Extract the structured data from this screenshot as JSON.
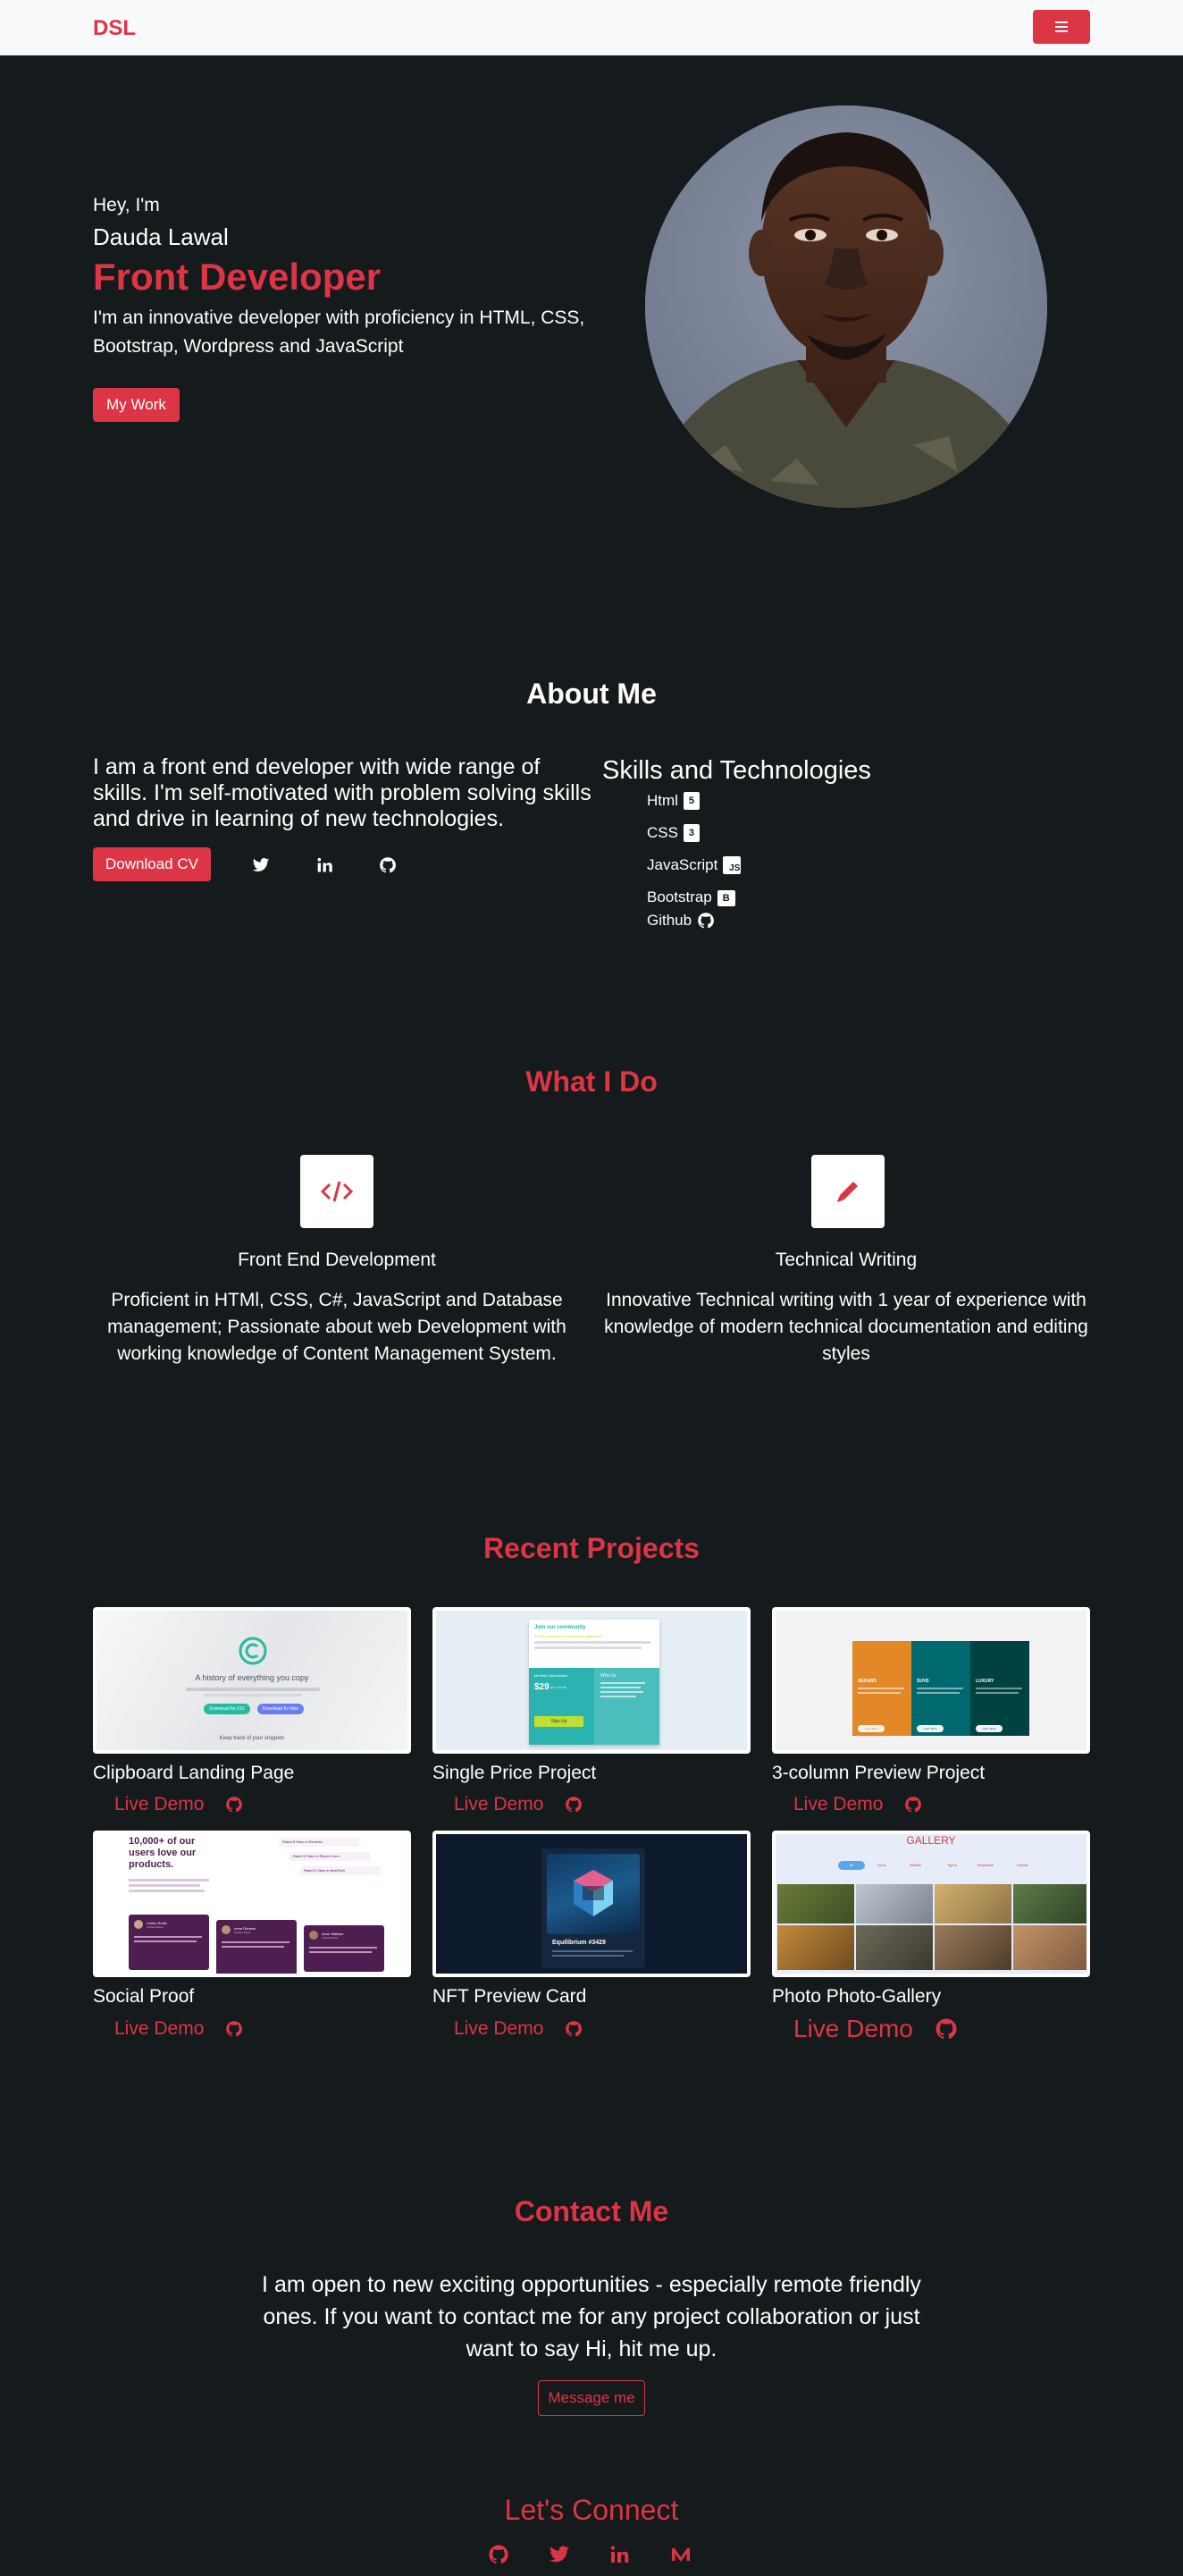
{
  "navbar": {
    "brand": "DSL",
    "toggler_icon": "hamburger-icon"
  },
  "hero": {
    "greeting": "Hey, I'm",
    "name": "Dauda Lawal",
    "title": "Front Developer",
    "description": "I'm an innovative developer with proficiency in HTML, CSS, Bootstrap, Wordpress and JavaScript",
    "button_label": "My Work"
  },
  "about": {
    "title": "About Me",
    "text": "I am a front end developer with wide range of skills. I'm self-motivated with problem solving skills and drive in learning of new technologies.",
    "cv_button": "Download CV",
    "social_icons": [
      "twitter-icon",
      "linkedin-icon",
      "github-icon"
    ],
    "skills_title": "Skills and Technologies",
    "skills": [
      {
        "label": "Html",
        "icon": "html5-icon"
      },
      {
        "label": "CSS",
        "icon": "css3-icon"
      },
      {
        "label": "JavaScript",
        "icon": "js-icon"
      },
      {
        "label": "Bootstrap",
        "icon": "bootstrap-icon"
      },
      {
        "label": "Github",
        "icon": "github-icon"
      }
    ]
  },
  "services": {
    "title": "What I Do",
    "items": [
      {
        "icon": "code-icon",
        "title": "Front End Development",
        "description": "Proficient in HTMl, CSS, C#, JavaScript and Database management; Passionate about web Development with working knowledge of Content Management System."
      },
      {
        "icon": "pencil-icon",
        "title": "Technical Writing",
        "description": "Innovative Technical writing with 1 year of experience with knowledge of modern technical documentation and editing styles"
      }
    ]
  },
  "projects": {
    "title": "Recent Projects",
    "demo_label": "Live Demo",
    "items": [
      {
        "name": "Clipboard Landing Page",
        "thumb": {
          "heading": "A history of everything you copy",
          "btn1": "Download for iOS",
          "btn2": "Download for Mac",
          "footer": "Keep track of your snippets"
        }
      },
      {
        "name": "Single Price Project",
        "thumb": {
          "heading": "Join our community",
          "subheading": "30-day, hassle-free money back guarantee",
          "sub_label": "Monthly Subscription",
          "price": "$29",
          "price_unit": "per month",
          "cta": "Sign Up",
          "why_label": "Why Us"
        }
      },
      {
        "name": "3-column Preview Project",
        "thumb": {
          "cols": [
            "SEDANS",
            "SUVS",
            "LUXURY"
          ],
          "btn": "Learn More"
        }
      },
      {
        "name": "Social Proof",
        "thumb": {
          "heading": "10,000+ of our users love our products.",
          "ratings": [
            "Rated 5 Stars in Reviews",
            "Rated 5 Stars in Report Guru",
            "Rated 5 Stars in BestTech"
          ],
          "reviewers": [
            "Colton Smith",
            "Irene Roberts",
            "Anne Wallace"
          ],
          "verified": "Verified Buyer"
        }
      },
      {
        "name": "NFT Preview Card",
        "thumb": {
          "title": "Equilibrium #3429"
        }
      },
      {
        "name": "Photo Photo-Gallery",
        "thumb": {
          "title": "GALLERY",
          "tabs": [
            "All",
            "Lions",
            "Wildlife",
            "Tigers",
            "Elephants",
            "Horses"
          ]
        }
      }
    ]
  },
  "contact": {
    "title": "Contact Me",
    "text": "I am open to new exciting opportunities - especially remote friendly ones. If you want to contact me for any project collaboration or just want to say Hi, hit me up.",
    "button": "Message me",
    "connect_title": "Let's Connect",
    "connect_icons": [
      "github-icon",
      "twitter-icon",
      "linkedin-icon",
      "medium-icon"
    ]
  },
  "colors": {
    "accent": "#dc3545",
    "background": "#151a1c",
    "navbar": "#f8f9fa"
  }
}
